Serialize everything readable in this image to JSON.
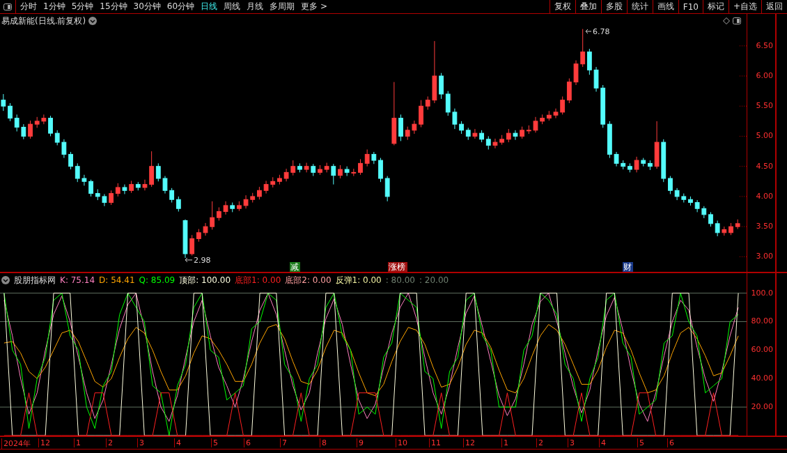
{
  "toolbar": {
    "periods": [
      {
        "label": "分时",
        "selected": false
      },
      {
        "label": "1分钟",
        "selected": false
      },
      {
        "label": "5分钟",
        "selected": false
      },
      {
        "label": "15分钟",
        "selected": false
      },
      {
        "label": "30分钟",
        "selected": false
      },
      {
        "label": "60分钟",
        "selected": false
      },
      {
        "label": "日线",
        "selected": true
      },
      {
        "label": "周线",
        "selected": false
      },
      {
        "label": "月线",
        "selected": false
      },
      {
        "label": "多周期",
        "selected": false
      },
      {
        "label": "更多 >",
        "selected": false
      }
    ],
    "buttons": [
      "复权",
      "叠加",
      "多股",
      "统计",
      "画线",
      "F10",
      "标记",
      "+自选",
      "返回"
    ]
  },
  "main_chart": {
    "title": "易成新能(日线.前复权)",
    "high_marker": "6.78",
    "low_marker": "2.98",
    "events": [
      {
        "label": "减",
        "color": "#1a7a1a"
      },
      {
        "label": "涨榜",
        "color": "#a01010"
      },
      {
        "label": "财",
        "color": "#1a3a8a"
      }
    ],
    "chart_data": {
      "type": "candlestick",
      "ylim": [
        2.75,
        7.03
      ],
      "yticks": [
        {
          "value": 6.5,
          "label": "6.50"
        },
        {
          "value": 6,
          "label": "6.00"
        },
        {
          "value": 5.5,
          "label": "5.50"
        },
        {
          "value": 5,
          "label": "5.00"
        },
        {
          "value": 4.5,
          "label": "4.50"
        },
        {
          "value": 4,
          "label": "4.00"
        },
        {
          "value": 3.5,
          "label": "3.50"
        },
        {
          "value": 3,
          "label": "3.00"
        }
      ],
      "categories": [
        null,
        null,
        null,
        null,
        null,
        null,
        null,
        null,
        null,
        null,
        null,
        null,
        null,
        null,
        null,
        null,
        null,
        null,
        null,
        null,
        null,
        null,
        null,
        null,
        null,
        null,
        null,
        null,
        null,
        null,
        null,
        null,
        null,
        null,
        null,
        null,
        null,
        null,
        null,
        null,
        null,
        null,
        null,
        null,
        null,
        null,
        null,
        null,
        null,
        null,
        null,
        null,
        null,
        null,
        null,
        null,
        null,
        null,
        null,
        null,
        null,
        null,
        null,
        null,
        null,
        null,
        null,
        null,
        null,
        null,
        null,
        null,
        null,
        null,
        null,
        null,
        null,
        null,
        null,
        null,
        null,
        null,
        null,
        null,
        null,
        null,
        null,
        null,
        null,
        null,
        null,
        null,
        null,
        null,
        null,
        null,
        null,
        null,
        null,
        null,
        null,
        null,
        null,
        null,
        null,
        null,
        null,
        null,
        null,
        null
      ],
      "ohlc": [
        [
          5.6,
          5.7,
          5.42,
          5.5
        ],
        [
          5.5,
          5.55,
          5.25,
          5.3
        ],
        [
          5.3,
          5.36,
          5.08,
          5.15
        ],
        [
          5.15,
          5.2,
          4.95,
          5.0
        ],
        [
          5.0,
          5.26,
          4.96,
          5.2
        ],
        [
          5.2,
          5.32,
          5.14,
          5.25
        ],
        [
          5.25,
          5.36,
          5.2,
          5.3
        ],
        [
          5.3,
          5.34,
          5.0,
          5.05
        ],
        [
          5.05,
          5.1,
          4.85,
          4.9
        ],
        [
          4.9,
          4.95,
          4.64,
          4.7
        ],
        [
          4.7,
          4.74,
          4.45,
          4.5
        ],
        [
          4.5,
          4.55,
          4.24,
          4.3
        ],
        [
          4.3,
          4.36,
          4.18,
          4.25
        ],
        [
          4.25,
          4.28,
          4.0,
          4.05
        ],
        [
          4.05,
          4.12,
          3.94,
          4.0
        ],
        [
          4.0,
          4.04,
          3.84,
          3.9
        ],
        [
          3.9,
          4.1,
          3.86,
          4.05
        ],
        [
          4.05,
          4.22,
          4.0,
          4.15
        ],
        [
          4.15,
          4.2,
          4.04,
          4.1
        ],
        [
          4.1,
          4.26,
          4.06,
          4.2
        ],
        [
          4.2,
          4.24,
          4.1,
          4.15
        ],
        [
          4.15,
          4.28,
          4.1,
          4.2
        ],
        [
          4.2,
          4.75,
          4.16,
          4.5
        ],
        [
          4.5,
          4.55,
          4.25,
          4.3
        ],
        [
          4.3,
          4.34,
          4.05,
          4.1
        ],
        [
          4.1,
          4.14,
          3.9,
          3.95
        ],
        [
          3.95,
          4.0,
          3.75,
          3.8
        ],
        [
          3.6,
          3.62,
          2.98,
          3.05
        ],
        [
          3.05,
          3.36,
          3.02,
          3.3
        ],
        [
          3.3,
          3.46,
          3.25,
          3.4
        ],
        [
          3.4,
          3.56,
          3.35,
          3.5
        ],
        [
          3.5,
          3.92,
          3.45,
          3.65
        ],
        [
          3.65,
          3.82,
          3.6,
          3.75
        ],
        [
          3.75,
          3.92,
          3.7,
          3.85
        ],
        [
          3.85,
          3.9,
          3.74,
          3.8
        ],
        [
          3.8,
          3.92,
          3.76,
          3.85
        ],
        [
          3.85,
          4.02,
          3.8,
          3.95
        ],
        [
          3.95,
          4.06,
          3.9,
          4.0
        ],
        [
          4.0,
          4.16,
          3.95,
          4.1
        ],
        [
          4.1,
          4.26,
          4.05,
          4.2
        ],
        [
          4.2,
          4.32,
          4.15,
          4.25
        ],
        [
          4.25,
          4.36,
          4.2,
          4.3
        ],
        [
          4.3,
          4.46,
          4.25,
          4.4
        ],
        [
          4.4,
          4.6,
          4.35,
          4.5
        ],
        [
          4.5,
          4.55,
          4.4,
          4.45
        ],
        [
          4.45,
          4.56,
          4.4,
          4.5
        ],
        [
          4.5,
          4.54,
          4.34,
          4.4
        ],
        [
          4.4,
          4.52,
          4.36,
          4.45
        ],
        [
          4.45,
          4.56,
          4.4,
          4.5
        ],
        [
          4.5,
          4.54,
          4.2,
          4.35
        ],
        [
          4.35,
          4.52,
          4.3,
          4.45
        ],
        [
          4.45,
          4.5,
          4.34,
          4.4
        ],
        [
          4.4,
          4.46,
          4.34,
          4.4
        ],
        [
          4.4,
          4.62,
          4.36,
          4.55
        ],
        [
          4.55,
          4.78,
          4.5,
          4.7
        ],
        [
          4.7,
          4.74,
          4.54,
          4.6
        ],
        [
          4.6,
          4.64,
          4.24,
          4.3
        ],
        [
          4.3,
          4.34,
          3.92,
          4.0
        ],
        [
          4.88,
          5.9,
          4.85,
          5.3
        ],
        [
          5.3,
          5.36,
          4.92,
          5.0
        ],
        [
          5.0,
          5.16,
          4.94,
          5.1
        ],
        [
          5.1,
          5.26,
          5.04,
          5.2
        ],
        [
          5.2,
          5.6,
          5.15,
          5.5
        ],
        [
          5.5,
          5.66,
          5.44,
          5.6
        ],
        [
          5.6,
          6.58,
          5.55,
          6.0
        ],
        [
          6.0,
          6.05,
          5.62,
          5.7
        ],
        [
          5.7,
          5.75,
          5.34,
          5.4
        ],
        [
          5.4,
          5.46,
          5.12,
          5.2
        ],
        [
          5.2,
          5.25,
          5.04,
          5.1
        ],
        [
          5.1,
          5.14,
          4.94,
          5.0
        ],
        [
          5.0,
          5.12,
          4.96,
          5.05
        ],
        [
          5.05,
          5.1,
          4.9,
          4.95
        ],
        [
          4.95,
          5.0,
          4.78,
          4.85
        ],
        [
          4.85,
          4.96,
          4.8,
          4.9
        ],
        [
          4.9,
          5.02,
          4.86,
          4.95
        ],
        [
          4.95,
          5.12,
          4.9,
          5.05
        ],
        [
          5.05,
          5.1,
          4.94,
          5.0
        ],
        [
          5.0,
          5.16,
          4.96,
          5.1
        ],
        [
          5.1,
          5.18,
          5.04,
          5.1
        ],
        [
          5.1,
          5.32,
          5.06,
          5.25
        ],
        [
          5.25,
          5.36,
          5.2,
          5.3
        ],
        [
          5.3,
          5.42,
          5.26,
          5.35
        ],
        [
          5.35,
          5.46,
          5.3,
          5.4
        ],
        [
          5.4,
          5.66,
          5.36,
          5.6
        ],
        [
          5.6,
          5.96,
          5.55,
          5.9
        ],
        [
          5.9,
          6.26,
          5.85,
          6.2
        ],
        [
          6.2,
          6.78,
          6.15,
          6.4
        ],
        [
          6.4,
          6.45,
          6.02,
          6.1
        ],
        [
          6.1,
          6.15,
          5.74,
          5.8
        ],
        [
          5.8,
          5.85,
          5.14,
          5.2
        ],
        [
          5.2,
          5.25,
          4.64,
          4.7
        ],
        [
          4.7,
          4.74,
          4.5,
          4.55
        ],
        [
          4.55,
          4.6,
          4.45,
          4.5
        ],
        [
          4.5,
          4.55,
          4.4,
          4.45
        ],
        [
          4.45,
          4.66,
          4.4,
          4.6
        ],
        [
          4.6,
          4.64,
          4.5,
          4.55
        ],
        [
          4.55,
          4.6,
          4.44,
          4.5
        ],
        [
          4.5,
          5.25,
          4.46,
          4.9
        ],
        [
          4.9,
          4.95,
          4.24,
          4.3
        ],
        [
          4.3,
          4.34,
          4.04,
          4.1
        ],
        [
          4.1,
          4.14,
          3.94,
          4.0
        ],
        [
          4.0,
          4.05,
          3.9,
          3.95
        ],
        [
          3.95,
          4.0,
          3.85,
          3.9
        ],
        [
          3.9,
          3.94,
          3.74,
          3.8
        ],
        [
          3.8,
          3.84,
          3.64,
          3.7
        ],
        [
          3.7,
          3.74,
          3.5,
          3.55
        ],
        [
          3.55,
          3.6,
          3.34,
          3.4
        ],
        [
          3.4,
          3.5,
          3.35,
          3.45
        ],
        [
          3.4,
          3.56,
          3.36,
          3.5
        ],
        [
          3.5,
          3.62,
          3.46,
          3.55
        ]
      ]
    }
  },
  "indicator": {
    "name": "股朋指标网",
    "legend_values": [
      ": 75.14",
      ": 54.41",
      ": 85.09",
      ": 100.00",
      ": 0.00"
    ],
    "extra_legend": [
      {
        "text": "底部2: 0.00",
        "color": "#ffa0a0"
      },
      {
        "text": "反弹1: 0.00",
        "color": "#f0f0a0"
      },
      {
        "text": ": 80.00",
        "color": "#708070"
      },
      {
        "text": ": 20.00",
        "color": "#708070"
      }
    ],
    "chart_data": {
      "type": "line",
      "ylim": [
        0,
        114
      ],
      "grid": true,
      "yticks": [
        {
          "value": 100,
          "label": "100.0"
        },
        {
          "value": 80,
          "label": "80.00"
        },
        {
          "value": 60,
          "label": "60.00"
        },
        {
          "value": 40,
          "label": "40.00"
        },
        {
          "value": 20,
          "label": "20.00"
        }
      ],
      "series": [
        {
          "name": "K",
          "color": "#ff80c0",
          "values": [
            95,
            70,
            40,
            15,
            30,
            60,
            85,
            98,
            80,
            55,
            30,
            12,
            25,
            50,
            75,
            92,
            100,
            75,
            45,
            20,
            10,
            28,
            55,
            80,
            95,
            70,
            48,
            35,
            20,
            40,
            66,
            88,
            100,
            85,
            60,
            35,
            18,
            30,
            58,
            82,
            96,
            78,
            50,
            25,
            12,
            22,
            48,
            72,
            90,
            100,
            82,
            55,
            30,
            15,
            35,
            62,
            86,
            98,
            76,
            52,
            28,
            14,
            26,
            50,
            78,
            94,
            100,
            80,
            58,
            34,
            16,
            32,
            60,
            84,
            97,
            74,
            46,
            22,
            10,
            30,
            56,
            80,
            95,
            88,
            62,
            40,
            24,
            45,
            70,
            90
          ]
        },
        {
          "name": "D",
          "color": "#ffa500",
          "values": [
            65,
            66,
            58,
            45,
            40,
            48,
            60,
            72,
            74,
            66,
            52,
            38,
            34,
            40,
            55,
            68,
            76,
            72,
            60,
            45,
            32,
            32,
            42,
            58,
            70,
            68,
            60,
            50,
            38,
            38,
            50,
            65,
            76,
            78,
            68,
            52,
            38,
            36,
            46,
            62,
            74,
            72,
            60,
            44,
            30,
            28,
            36,
            52,
            66,
            76,
            74,
            64,
            48,
            34,
            36,
            48,
            64,
            74,
            72,
            62,
            46,
            32,
            30,
            40,
            56,
            70,
            78,
            74,
            64,
            50,
            36,
            36,
            46,
            62,
            74,
            72,
            60,
            44,
            30,
            32,
            42,
            58,
            72,
            76,
            68,
            56,
            42,
            44,
            56,
            70
          ]
        },
        {
          "name": "Q",
          "color": "#00ff00",
          "values": [
            100,
            60,
            50,
            5,
            40,
            55,
            95,
            100,
            70,
            60,
            20,
            5,
            35,
            45,
            85,
            100,
            90,
            80,
            35,
            30,
            0,
            35,
            50,
            90,
            100,
            60,
            55,
            25,
            30,
            35,
            75,
            80,
            100,
            95,
            50,
            40,
            10,
            40,
            50,
            90,
            100,
            70,
            60,
            15,
            20,
            15,
            55,
            65,
            100,
            95,
            90,
            45,
            40,
            5,
            45,
            55,
            95,
            100,
            70,
            60,
            20,
            20,
            20,
            60,
            70,
            100,
            95,
            85,
            50,
            40,
            10,
            40,
            55,
            95,
            100,
            65,
            55,
            15,
            20,
            25,
            65,
            70,
            100,
            80,
            70,
            30,
            35,
            40,
            80,
            85
          ]
        },
        {
          "name": "顶部",
          "color": "#ffffe0",
          "values": [
            100,
            0,
            0,
            0,
            0,
            0,
            100,
            100,
            100,
            0,
            0,
            0,
            0,
            0,
            0,
            100,
            100,
            0,
            0,
            0,
            0,
            0,
            0,
            100,
            100,
            0,
            0,
            0,
            0,
            0,
            0,
            100,
            100,
            100,
            0,
            0,
            0,
            0,
            0,
            100,
            100,
            0,
            0,
            0,
            0,
            0,
            0,
            0,
            100,
            100,
            100,
            0,
            0,
            0,
            0,
            0,
            100,
            100,
            0,
            0,
            0,
            0,
            0,
            0,
            0,
            100,
            100,
            100,
            0,
            0,
            0,
            0,
            0,
            100,
            100,
            0,
            0,
            0,
            0,
            0,
            0,
            100,
            100,
            100,
            0,
            0,
            0,
            0,
            0,
            100
          ]
        },
        {
          "name": "底部1",
          "color": "#ff2020",
          "values": [
            0,
            0,
            0,
            30,
            0,
            0,
            0,
            0,
            0,
            0,
            0,
            30,
            30,
            0,
            0,
            0,
            0,
            0,
            0,
            30,
            30,
            0,
            0,
            0,
            0,
            0,
            0,
            0,
            30,
            0,
            0,
            0,
            0,
            0,
            0,
            0,
            30,
            0,
            0,
            0,
            0,
            0,
            0,
            30,
            30,
            30,
            0,
            0,
            0,
            0,
            0,
            0,
            0,
            30,
            0,
            0,
            0,
            0,
            0,
            0,
            0,
            30,
            0,
            0,
            0,
            0,
            0,
            0,
            0,
            0,
            30,
            0,
            0,
            0,
            0,
            0,
            0,
            30,
            30,
            0,
            0,
            0,
            0,
            0,
            0,
            0,
            30,
            0,
            0,
            0
          ]
        }
      ]
    }
  },
  "date_axis": [
    "2024年",
    "12",
    "1",
    "2",
    "3",
    "4",
    "5",
    "6",
    "7",
    "8",
    "9",
    "10",
    "11",
    "12",
    "1",
    "2",
    "3",
    "4",
    "5",
    "6"
  ]
}
